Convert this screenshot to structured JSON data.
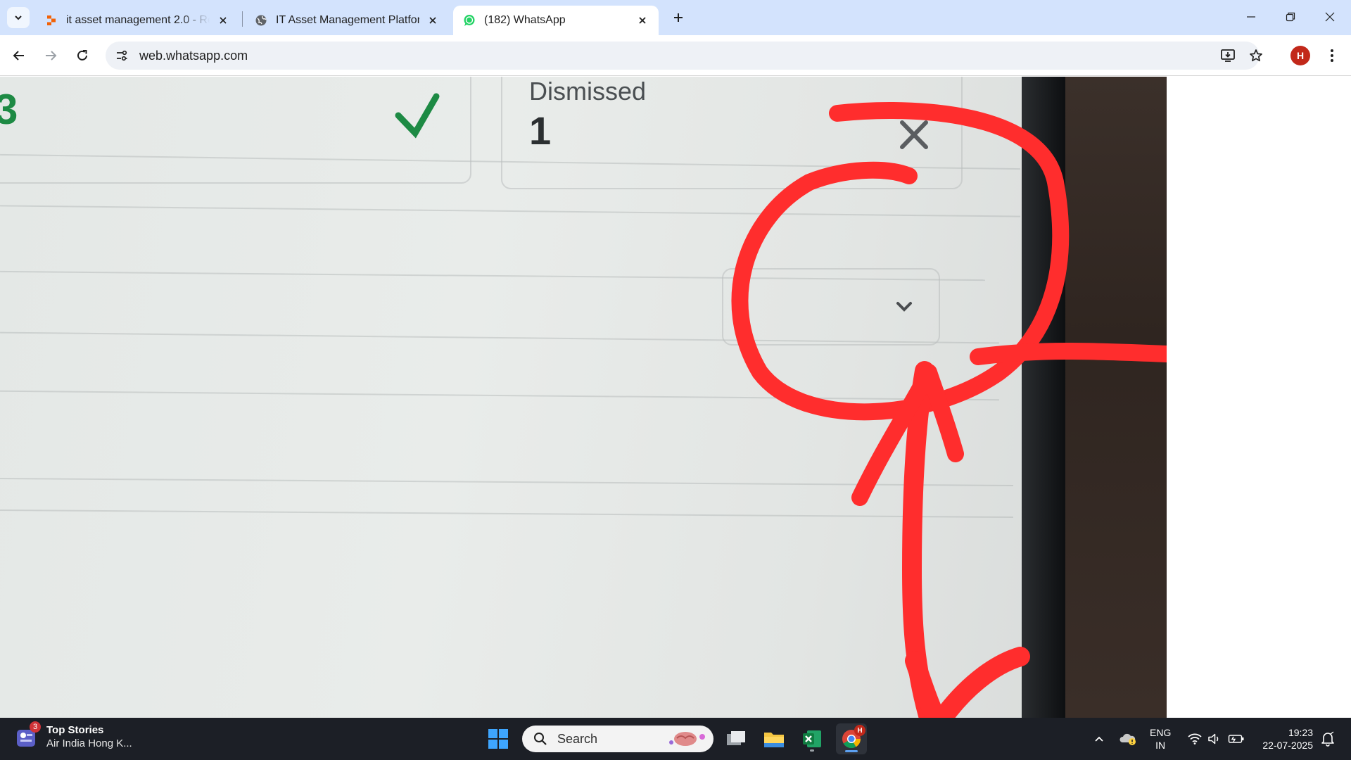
{
  "browser": {
    "tabs": [
      {
        "title": "it asset management 2.0 - Replit",
        "favicon": "replit-icon",
        "active": false
      },
      {
        "title": "IT Asset Management Platform",
        "favicon": "globe-icon",
        "active": false
      },
      {
        "title": "(182) WhatsApp",
        "favicon": "whatsapp-icon",
        "active": true
      }
    ],
    "url": "web.whatsapp.com",
    "profile_initial": "H"
  },
  "photo": {
    "dismissed_label": "Dismissed",
    "dismissed_value": "1",
    "partial_number": "3",
    "annotation_color": "#ff2d2d",
    "check_color": "#1d8a44"
  },
  "taskbar": {
    "widget": {
      "title": "Top Stories",
      "subtitle": "Air India Hong K...",
      "badge": "3"
    },
    "search_placeholder": "Search",
    "language": {
      "line1": "ENG",
      "line2": "IN"
    },
    "clock": {
      "time": "19:23",
      "date": "22-07-2025"
    },
    "chrome_badge": "H"
  }
}
